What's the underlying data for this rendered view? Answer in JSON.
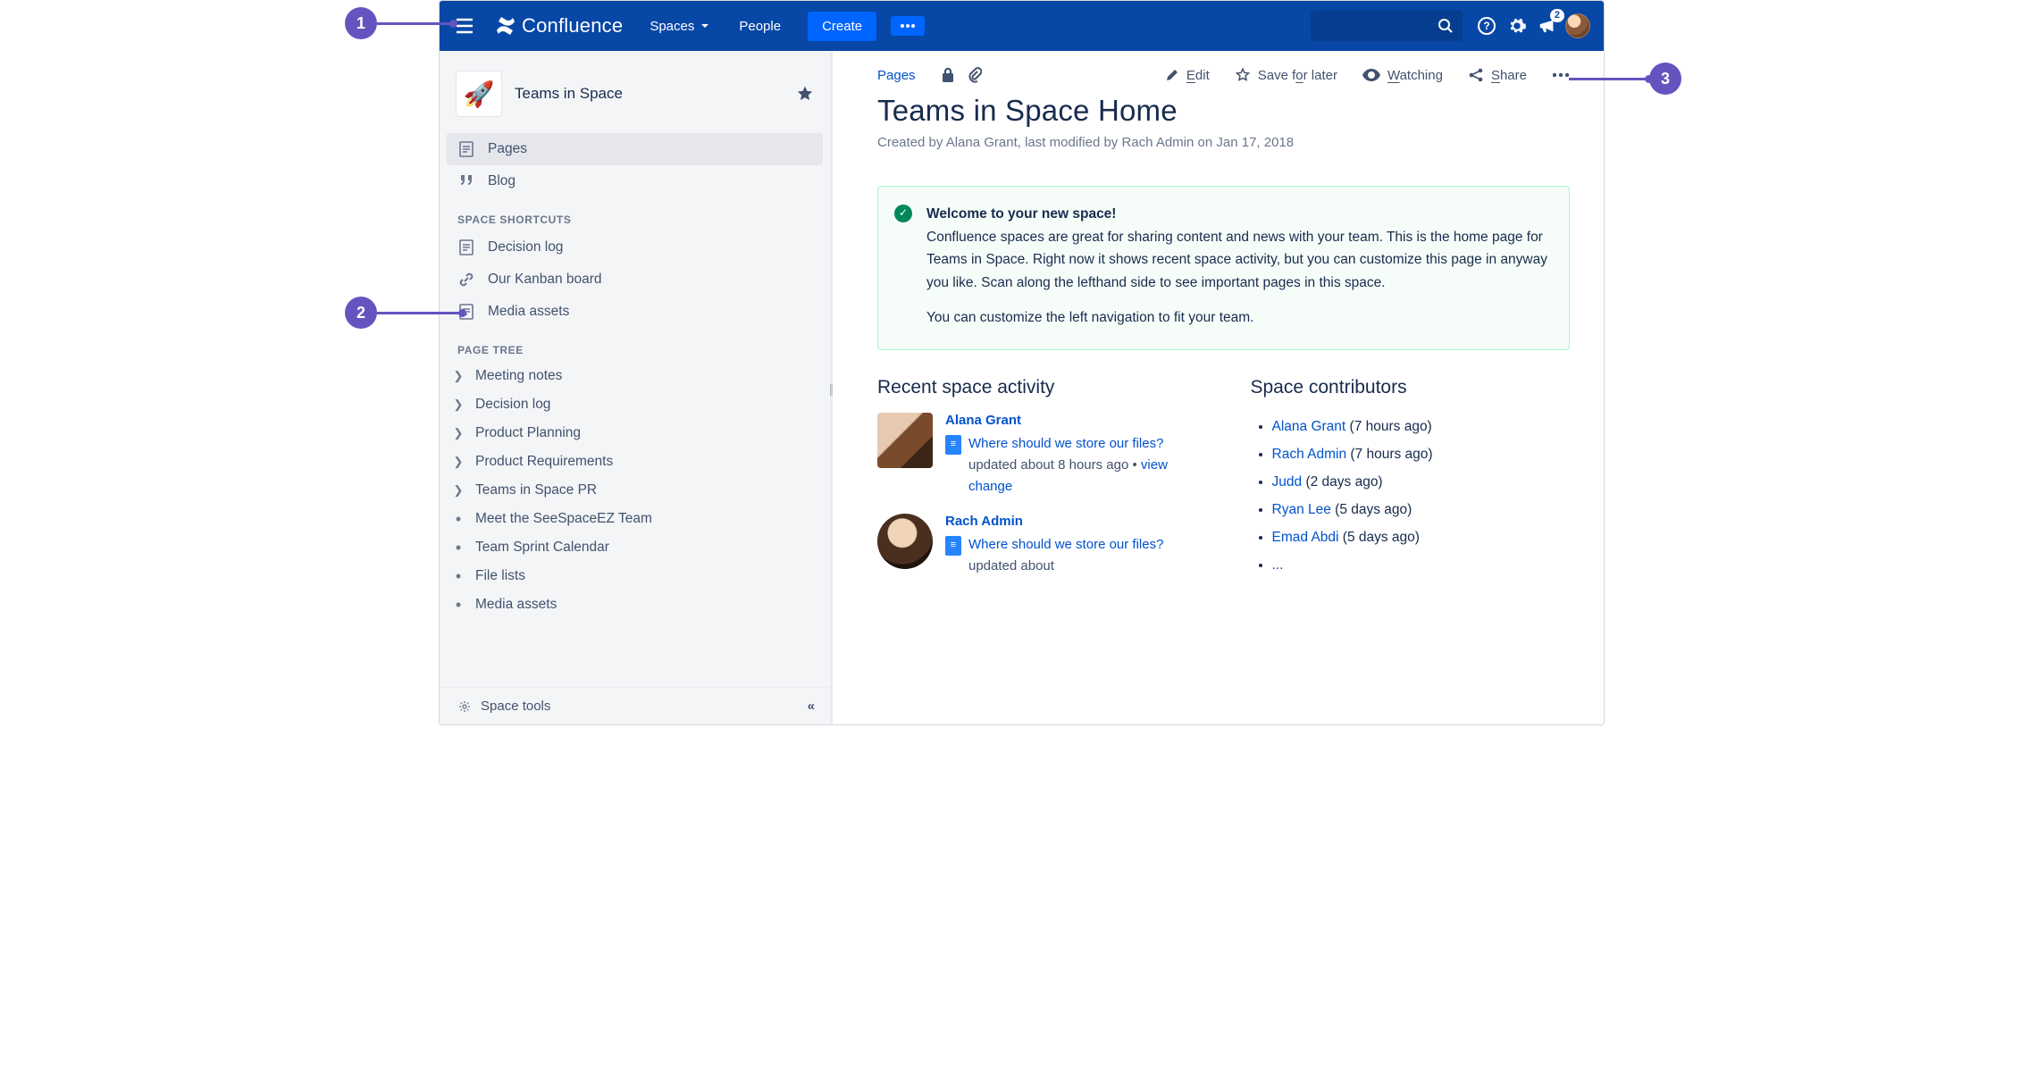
{
  "annotations": {
    "a1": "1",
    "a2": "2",
    "a3": "3"
  },
  "topnav": {
    "product": "Confluence",
    "spaces": "Spaces",
    "people": "People",
    "create": "Create",
    "notification_count": "2"
  },
  "sidebar": {
    "space_name": "Teams in Space",
    "nav": {
      "pages": "Pages",
      "blog": "Blog"
    },
    "shortcuts_label": "SPACE SHORTCUTS",
    "shortcuts": [
      {
        "icon": "page",
        "label": "Decision log"
      },
      {
        "icon": "link",
        "label": "Our Kanban board"
      },
      {
        "icon": "page",
        "label": "Media assets"
      }
    ],
    "tree_label": "PAGE TREE",
    "tree": [
      {
        "exp": true,
        "label": "Meeting notes"
      },
      {
        "exp": true,
        "label": "Decision log"
      },
      {
        "exp": true,
        "label": "Product Planning"
      },
      {
        "exp": true,
        "label": "Product Requirements"
      },
      {
        "exp": true,
        "label": "Teams in Space PR"
      },
      {
        "exp": false,
        "label": "Meet the SeeSpaceEZ Team"
      },
      {
        "exp": false,
        "label": "Team Sprint Calendar"
      },
      {
        "exp": false,
        "label": "File lists"
      },
      {
        "exp": false,
        "label": "Media assets"
      }
    ],
    "tools": "Space tools"
  },
  "actions": {
    "pages": "Pages",
    "edit": "Edit",
    "edit_u": "E",
    "save": "Save for later",
    "save_pre": "Save f",
    "save_u": "o",
    "save_post": "r later",
    "watching": "Watching",
    "watch_u": "W",
    "watch_post": "atching",
    "share": "Share",
    "share_u": "S",
    "share_post": "hare"
  },
  "page": {
    "title": "Teams in Space Home",
    "meta": "Created by Alana Grant, last modified by Rach Admin on Jan 17, 2018"
  },
  "welcome": {
    "title": "Welcome to your new space!",
    "body": "Confluence spaces are great for sharing content and news with your team. This is the home page for Teams in Space. Right now it shows recent space activity, but you can customize this page in anyway you like. Scan along the lefthand side to see important pages in this space.",
    "body2": "You can customize the left navigation to fit your team."
  },
  "activity": {
    "heading": "Recent space activity",
    "items": [
      {
        "user": "Alana Grant",
        "link": "Where should we store our files?",
        "meta": "updated about 8 hours ago",
        "change": "view change",
        "avatar_css": "linear-gradient(135deg,#e8c9b0 0 40%,#7a4a2d 42% 70%,#3a2517 72% 100%)"
      },
      {
        "user": "Rach Admin",
        "link": "Where should we store our files?",
        "meta": "updated about",
        "change": "",
        "avatar_css": "radial-gradient(circle at 45% 35%,#f2d4b8 0 30%,#4a2f1e 32% 65%,#1e140c 67% 100%)"
      }
    ]
  },
  "contributors": {
    "heading": "Space contributors",
    "items": [
      {
        "name": "Alana Grant",
        "when": "(7 hours ago)"
      },
      {
        "name": "Rach Admin",
        "when": "(7 hours ago)"
      },
      {
        "name": "Judd",
        "when": "(2 days ago)"
      },
      {
        "name": "Ryan Lee",
        "when": "(5 days ago)"
      },
      {
        "name": "Emad Abdi",
        "when": "(5 days ago)"
      }
    ],
    "more": "..."
  }
}
